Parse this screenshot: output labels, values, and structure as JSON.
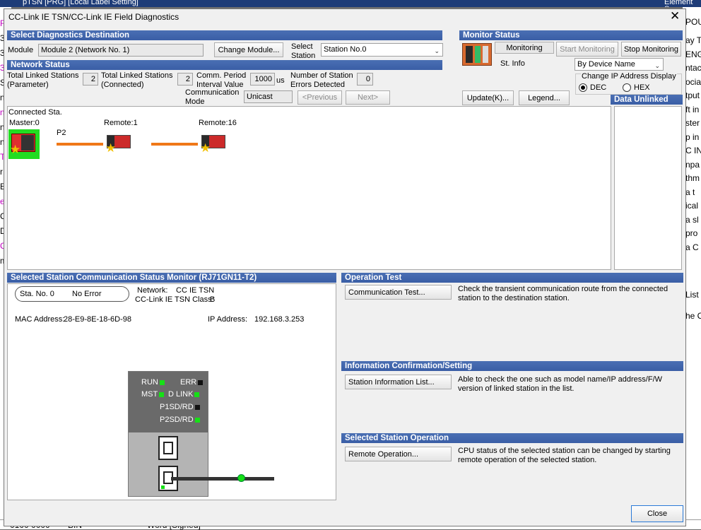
{
  "background_app": {
    "title": "pTSN [PRG] [Local Label Setting]",
    "right_title": "Element Se",
    "left_snippets": [
      "FL",
      "30",
      "31",
      "32",
      "Su",
      "ne",
      "na",
      "na",
      "na",
      "T",
      "r",
      "E",
      "e",
      "C-",
      "D",
      "C",
      "m"
    ],
    "right_snippets": [
      "ay T",
      "ENG",
      "ntac",
      "ocial",
      "tput",
      "ft in",
      "ster",
      "p in",
      "C IN",
      "npa",
      "thm",
      "a t",
      "ical",
      "a sl",
      "pro",
      "a C",
      "List",
      "he C"
    ],
    "right_tab": "POU",
    "bottom_cells": [
      "0100 0000",
      "BIN",
      "Word [Signed]",
      "--",
      "--"
    ]
  },
  "dialog": {
    "title": "CC-Link IE TSN/CC-Link IE Field Diagnostics",
    "close_glyph": "✕",
    "close_button": "Close"
  },
  "diag_dest": {
    "header": "Select Diagnostics Destination",
    "module_label": "Module",
    "module_value": "Module 2 (Network No. 1)",
    "change_module_button": "Change Module...",
    "select_station_label": "Select\nStation",
    "station_value": "Station No.0"
  },
  "network_status": {
    "header": "Network Status",
    "total_param_label": "Total Linked Stations\n(Parameter)",
    "total_param_value": "2",
    "total_conn_label": "Total Linked Stations\n(Connected)",
    "total_conn_value": "2",
    "comm_period_label": "Comm. Period\nInterval Value",
    "comm_period_value": "1000",
    "comm_period_unit": "us",
    "errors_label": "Number of Station\nErrors Detected",
    "errors_value": "0",
    "comm_mode_label": "Communication\nMode",
    "comm_mode_value": "Unicast",
    "prev_button": "<Previous",
    "next_button": "Next>"
  },
  "monitor_status": {
    "header": "Monitor Status",
    "monitoring_button": "Monitoring",
    "start_button": "Start Monitoring",
    "stop_button": "Stop Monitoring",
    "st_info_label": "St. Info",
    "device_name_select": "By Device Name",
    "ip_display_label": "Change IP Address Display",
    "dec_label": "DEC",
    "hex_label": "HEX",
    "update_button": "Update(K)...",
    "legend_button": "Legend..."
  },
  "topology": {
    "connected_label": "Connected Sta.",
    "master_label": "Master:0",
    "port_label": "P2",
    "remote1_label": "Remote:1",
    "remote16_label": "Remote:16"
  },
  "data_unlinked": {
    "header": "Data Unlinked"
  },
  "selected_station": {
    "header": "Selected Station Communication Status Monitor (RJ71GN11-T2)",
    "sta_no": "Sta. No. 0",
    "status": "No Error",
    "network_label": "Network:",
    "network_value": "CC IE TSN",
    "class_label": "CC-Link IE TSN Class:",
    "class_value": "B",
    "mac_label": "MAC Address:",
    "mac_value": "28-E9-8E-18-6D-98",
    "ip_label": "IP Address:",
    "ip_value": "192.168.3.253",
    "leds": {
      "run": "RUN",
      "err": "ERR",
      "mst": "MST",
      "dlink": "D LINK",
      "p1": "P1SD/RD",
      "p2": "P2SD/RD"
    }
  },
  "operation_test": {
    "header": "Operation Test",
    "button": "Communication Test...",
    "description": "Check the transient communication route from the connected station to the destination station."
  },
  "info_confirm": {
    "header": "Information Confirmation/Setting",
    "button": "Station Information List...",
    "description": "Able to check the one such as model name/IP address/F/W version of linked station in the list."
  },
  "station_operation": {
    "header": "Selected Station Operation",
    "button": "Remote Operation...",
    "description": "CPU status of the selected station can be changed by starting remote operation of the selected station."
  },
  "colors": {
    "header_blue": "#3a5ea6",
    "link_orange": "#f07818",
    "led_green": "#16e016",
    "master_green": "#22dd22"
  }
}
